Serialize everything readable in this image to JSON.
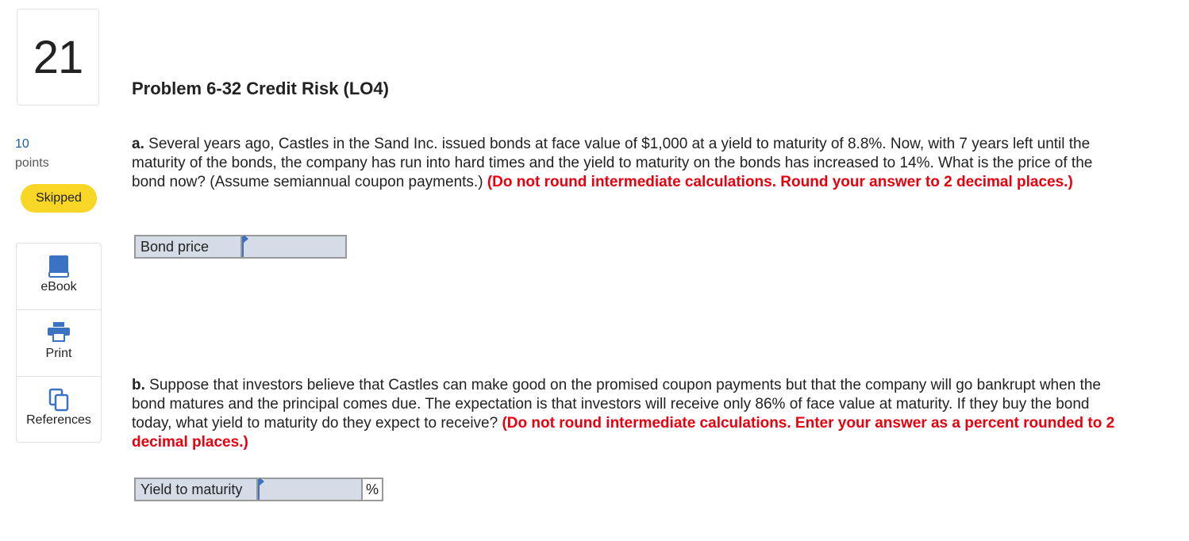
{
  "question": {
    "number": "21",
    "title": "Problem 6-32 Credit Risk (LO4)",
    "points_value": "10",
    "points_label": "points",
    "status": "Skipped"
  },
  "tools": {
    "ebook": "eBook",
    "print": "Print",
    "references": "References"
  },
  "part_a": {
    "letter": "a.",
    "text": "Several years ago, Castles in the Sand Inc. issued bonds at face value of $1,000 at a yield to maturity of 8.8%. Now, with 7 years left until the maturity of the bonds, the company has run into hard times and the yield to maturity on the bonds has increased to 14%. What is the price of the bond now? (Assume semiannual coupon payments.)",
    "instruction": "(Do not round intermediate calculations. Round your answer to 2 decimal places.)",
    "answer_label": "Bond price",
    "answer_value": ""
  },
  "part_b": {
    "letter": "b.",
    "text": "Suppose that investors believe that Castles can make good on the promised coupon payments but that the company will go bankrupt when the bond matures and the principal comes due. The expectation is that investors will receive only 86% of face value at maturity. If they buy the bond today, what yield to maturity do they expect to receive?",
    "instruction": "(Do not round intermediate calculations. Enter your answer as a percent rounded to 2 decimal places.)",
    "answer_label": "Yield to maturity",
    "answer_value": "",
    "answer_unit": "%"
  },
  "colors": {
    "accent_blue": "#1f5fa8",
    "skipped_badge": "#f8d626",
    "instruction_red": "#e8000f",
    "input_bg": "#d6dce7"
  }
}
